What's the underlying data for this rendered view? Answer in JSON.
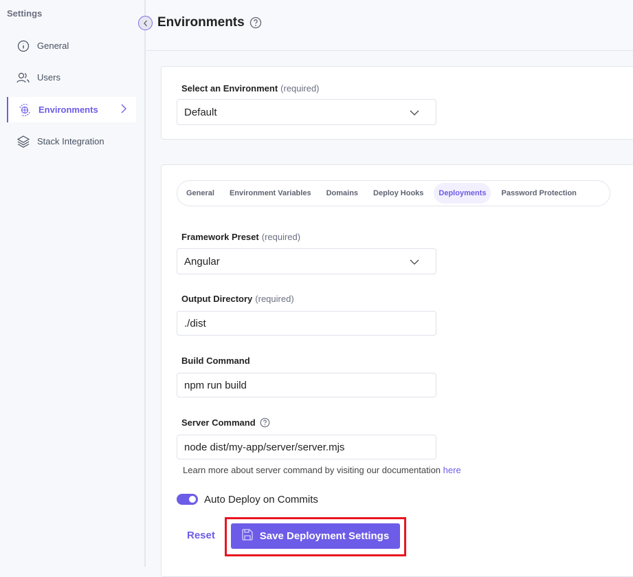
{
  "sidebar": {
    "title": "Settings",
    "items": [
      {
        "label": "General",
        "icon": "info-icon"
      },
      {
        "label": "Users",
        "icon": "users-icon"
      },
      {
        "label": "Environments",
        "icon": "globe-sync-icon",
        "active": true
      },
      {
        "label": "Stack Integration",
        "icon": "layers-icon"
      }
    ]
  },
  "header": {
    "title": "Environments"
  },
  "env_select": {
    "label": "Select an Environment",
    "required": "(required)",
    "value": "Default"
  },
  "tabs": [
    "General",
    "Environment Variables",
    "Domains",
    "Deploy Hooks",
    "Deployments",
    "Password Protection"
  ],
  "active_tab": "Deployments",
  "form": {
    "framework": {
      "label": "Framework Preset",
      "required": "(required)",
      "value": "Angular"
    },
    "output": {
      "label": "Output Directory",
      "required": "(required)",
      "value": "./dist"
    },
    "build": {
      "label": "Build Command",
      "value": "npm run build"
    },
    "server": {
      "label": "Server Command",
      "value": "node dist/my-app/server/server.mjs"
    },
    "hint": "Learn more about server command by visiting our documentation",
    "hint_link": "here",
    "auto_deploy": {
      "label": "Auto Deploy on Commits",
      "enabled": true
    }
  },
  "actions": {
    "reset": "Reset",
    "save": "Save Deployment Settings"
  },
  "colors": {
    "accent": "#6c5ce7",
    "highlight": "#e8141f"
  }
}
